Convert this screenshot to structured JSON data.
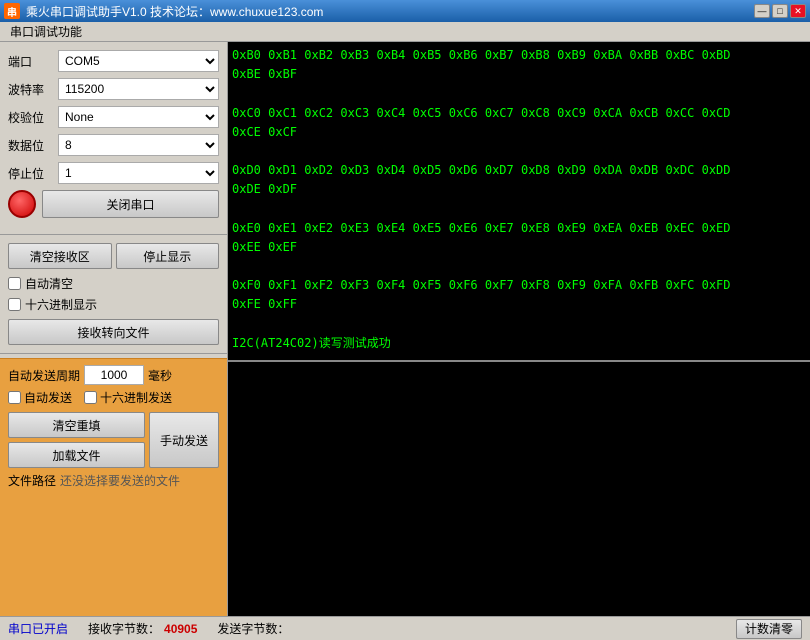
{
  "titleBar": {
    "title": "乘火串口调试助手V1.0   技术论坛：www.chuxue123.com",
    "minimizeBtn": "—",
    "maximizeBtn": "□",
    "closeBtn": "✕"
  },
  "menuBar": {
    "items": [
      "串口调试功能"
    ]
  },
  "portSettings": {
    "portLabel": "端口",
    "portValue": "COM5",
    "baudLabel": "波特率",
    "baudValue": "115200",
    "parityLabel": "校验位",
    "parityValue": "None",
    "dataLabel": "数据位",
    "dataValue": "8",
    "stopLabel": "停止位",
    "stopValue": "1",
    "closePortBtn": "关闭串口"
  },
  "receiveArea": {
    "clearBtn": "清空接收区",
    "stopBtn": "停止显示",
    "autoCleanLabel": "自动清空",
    "hexDisplayLabel": "十六进制显示",
    "recvToFileBtn": "接收转向文件"
  },
  "content": {
    "recvText": "0xB0 0xB1 0xB2 0xB3 0xB4 0xB5 0xB6 0xB7 0xB8 0xB9 0xBA 0xBB 0xBC 0xBD\n0xBE 0xBF\n\n0xC0 0xC1 0xC2 0xC3 0xC4 0xC5 0xC6 0xC7 0xC8 0xC9 0xCA 0xCB 0xCC 0xCD\n0xCE 0xCF\n\n0xD0 0xD1 0xD2 0xD3 0xD4 0xD5 0xD6 0xD7 0xD8 0xD9 0xDA 0xDB 0xDC 0xDD\n0xDE 0xDF\n\n0xE0 0xE1 0xE2 0xE3 0xE4 0xE5 0xE6 0xE7 0xE8 0xE9 0xEA 0xEB 0xEC 0xED\n0xEE 0xEF\n\n0xF0 0xF1 0xF2 0xF3 0xF4 0xF5 0xF6 0xF7 0xF8 0xF9 0xFA 0xFB 0xFC 0xFD\n0xFE 0xFF\n\nI2C(AT24C02)读写测试成功"
  },
  "sendSection": {
    "periodLabel": "自动发送周期",
    "periodValue": "1000",
    "msLabel": "毫秒",
    "autoSendLabel": "自动发送",
    "hexSendLabel": "十六进制发送",
    "clearResendBtn": "清空重填",
    "loadFileBtn": "加载文件",
    "manualSendBtn": "手动发送",
    "filePathLabel": "文件路径",
    "filePathValue": "还没选择要发送的文件"
  },
  "statusBar": {
    "portStatus": "串口已开启",
    "recvCountLabel": "接收字节数：",
    "recvCount": "40905",
    "sendCountLabel": "发送字节数：",
    "sendCount": "",
    "calcClearBtn": "计数清零"
  }
}
